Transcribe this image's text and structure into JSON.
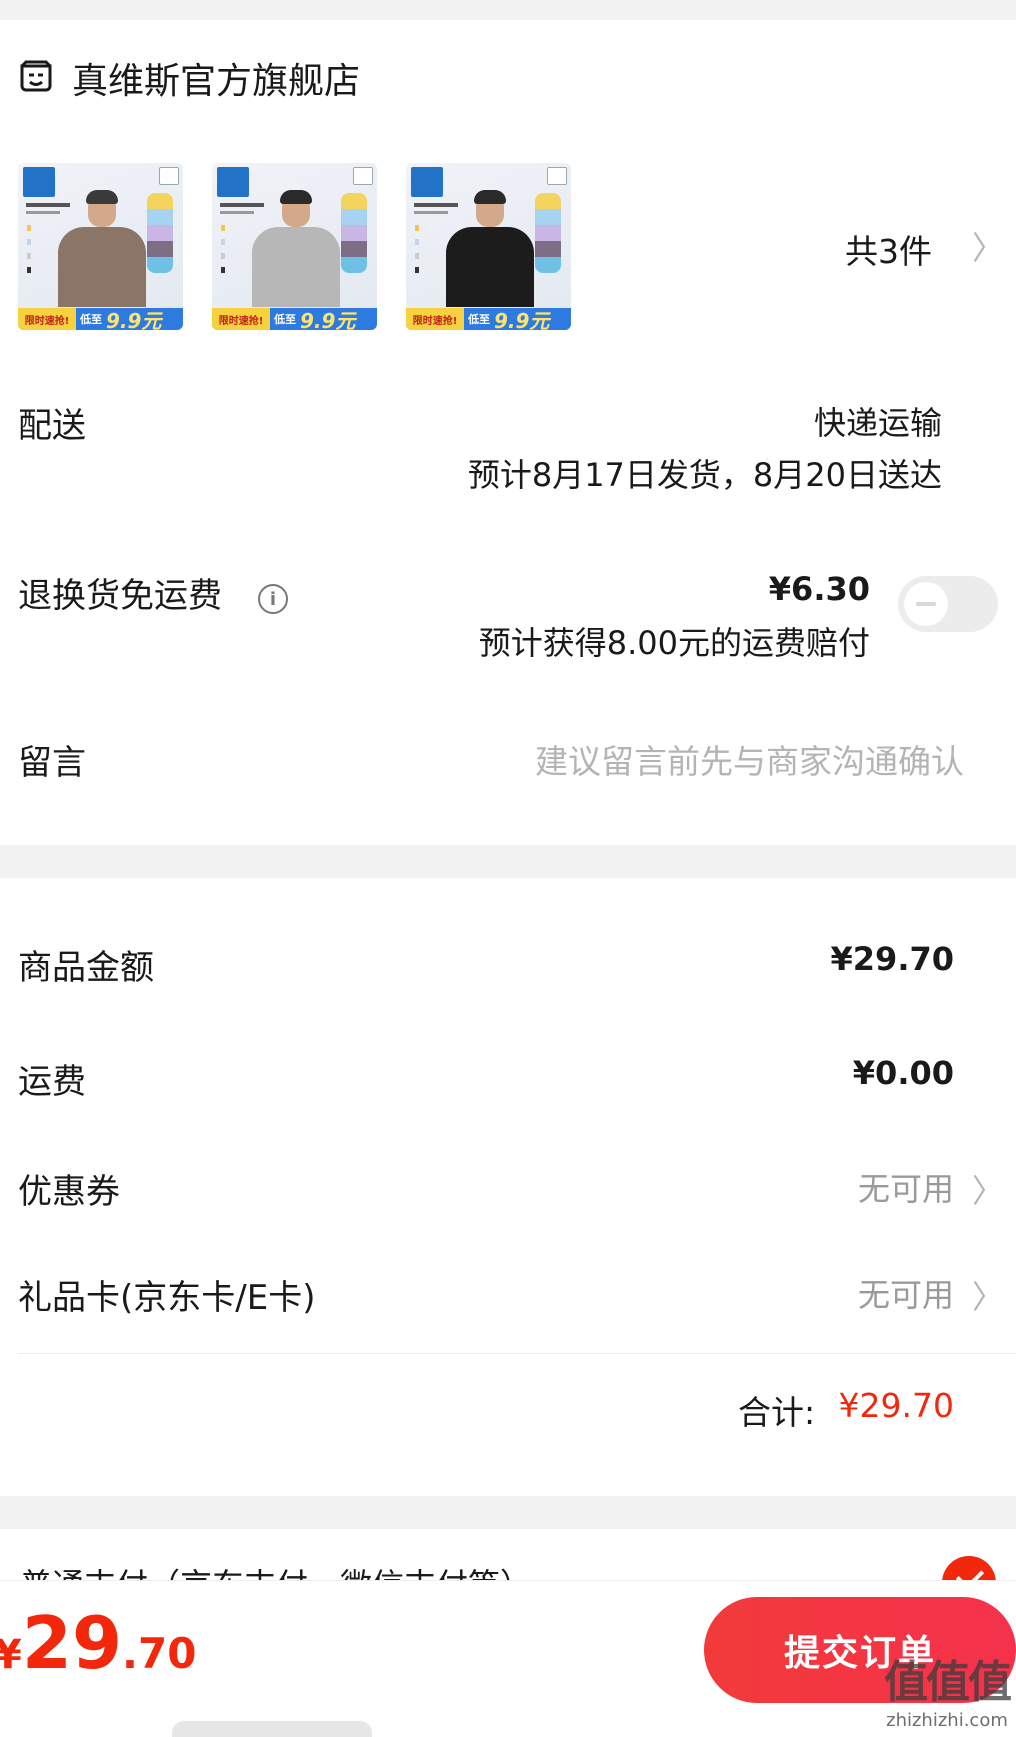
{
  "store": {
    "name": "真维斯官方旗舰店"
  },
  "products": {
    "thumbs": [
      {
        "badge": "男女同款",
        "subtitle": "字母印花T",
        "promo_left": "限时速抢!",
        "promo_mid": "低至",
        "promo_price": "9.9元",
        "shirt_color": "#8b7566"
      },
      {
        "badge": "男女同款",
        "subtitle": "字母印花T",
        "promo_left": "限时速抢!",
        "promo_mid": "低至",
        "promo_price": "9.9元",
        "shirt_color": "#b7b7b7"
      },
      {
        "badge": "男女同款",
        "subtitle": "字母印花T",
        "promo_left": "限时速抢!",
        "promo_mid": "低至",
        "promo_price": "9.9元",
        "shirt_color": "#1c1c1c"
      }
    ],
    "count_label": "共3件"
  },
  "delivery": {
    "label": "配送",
    "method": "快递运输",
    "estimate": "预计8月17日发货，8月20日送达"
  },
  "return_shipping": {
    "label": "退换货免运费",
    "info_icon": "i",
    "price": "¥6.30",
    "note": "预计获得8.00元的运费赔付",
    "enabled": false
  },
  "message": {
    "label": "留言",
    "placeholder": "建议留言前先与商家沟通确认"
  },
  "summary": {
    "goods_label": "商品金额",
    "goods_value": "¥29.70",
    "shipping_label": "运费",
    "shipping_value": "¥0.00",
    "coupon_label": "优惠券",
    "coupon_value": "无可用",
    "giftcard_label": "礼品卡(京东卡/E卡)",
    "giftcard_value": "无可用",
    "total_label": "合计:",
    "total_value": "¥29.70"
  },
  "payment": {
    "method_label": "普通支付（京东支付、微信支付等）"
  },
  "bottom": {
    "currency": "¥",
    "price_int": "29",
    "price_dec": ".70",
    "submit_label": "提交订单"
  },
  "watermark": {
    "main": "值值值",
    "sub": "zhizhizhi.com"
  },
  "colors": {
    "accent": "#f2270c",
    "button": "#f23a3a",
    "background": "#f2f2f2"
  }
}
